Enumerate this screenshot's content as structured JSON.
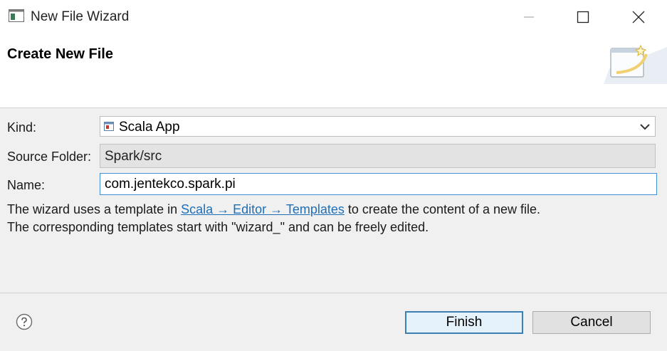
{
  "window": {
    "title": "New File Wizard"
  },
  "header": {
    "title": "Create New File"
  },
  "form": {
    "kind_label": "Kind:",
    "kind_value": "Scala App",
    "source_folder_label": "Source Folder:",
    "source_folder_value": "Spark/src",
    "name_label": "Name:",
    "name_value": "com.jentekco.spark.pi"
  },
  "info": {
    "line1_prefix": "The wizard uses a template in ",
    "line1_link": "Scala → Editor → Templates",
    "line1_suffix": " to create the content of a new file.",
    "line2": "The corresponding templates start with \"wizard_\" and can be freely edited."
  },
  "buttons": {
    "finish": "Finish",
    "cancel": "Cancel"
  },
  "icons": {
    "app": "window-icon",
    "minimize": "minimize-icon",
    "maximize": "maximize-icon",
    "close": "close-icon",
    "banner": "new-file-wizard-icon",
    "kind_item": "scala-file-icon",
    "dropdown": "chevron-down-icon",
    "help": "help-icon"
  },
  "colors": {
    "link": "#1f6fb8",
    "focus_border": "#3f8fd6",
    "default_button_border": "#3c7fb1"
  }
}
